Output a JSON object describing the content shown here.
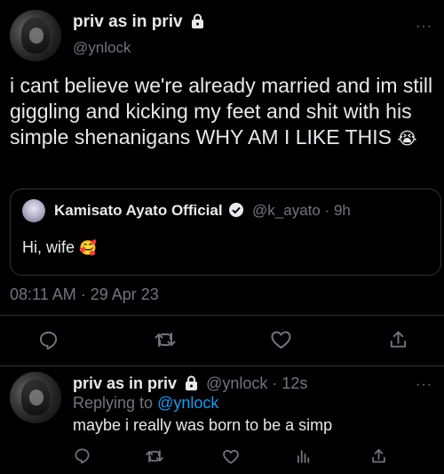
{
  "main_tweet": {
    "display_name": "priv as in priv",
    "handle": "@ynlock",
    "text": "i cant believe we're already married and im still giggling and kicking my feet and shit with his simple shenanigans WHY AM I LIKE THIS",
    "emoji": "😭",
    "timestamp": "08:11 AM · 29 Apr 23",
    "more_label": "···"
  },
  "quoted_tweet": {
    "display_name": "Kamisato Ayato Official",
    "handle": "@k_ayato",
    "time": "· 9h",
    "text": "Hi, wife",
    "emoji": "🥰"
  },
  "reply": {
    "display_name": "priv as in priv",
    "handle": "@ynlock",
    "time": "· 12s",
    "replying_prefix": "Replying to",
    "replying_to": "@ynlock",
    "text": "maybe i really was born to be a simp",
    "more_label": "···"
  },
  "colors": {
    "background": "#000000",
    "text": "#e7e9ea",
    "muted": "#71767b",
    "accent": "#1d9bf0",
    "border": "#2f3336"
  },
  "icons": [
    "lock-icon",
    "verified-badge-icon",
    "reply-icon",
    "retweet-icon",
    "like-icon",
    "views-icon",
    "share-icon",
    "more-icon"
  ]
}
